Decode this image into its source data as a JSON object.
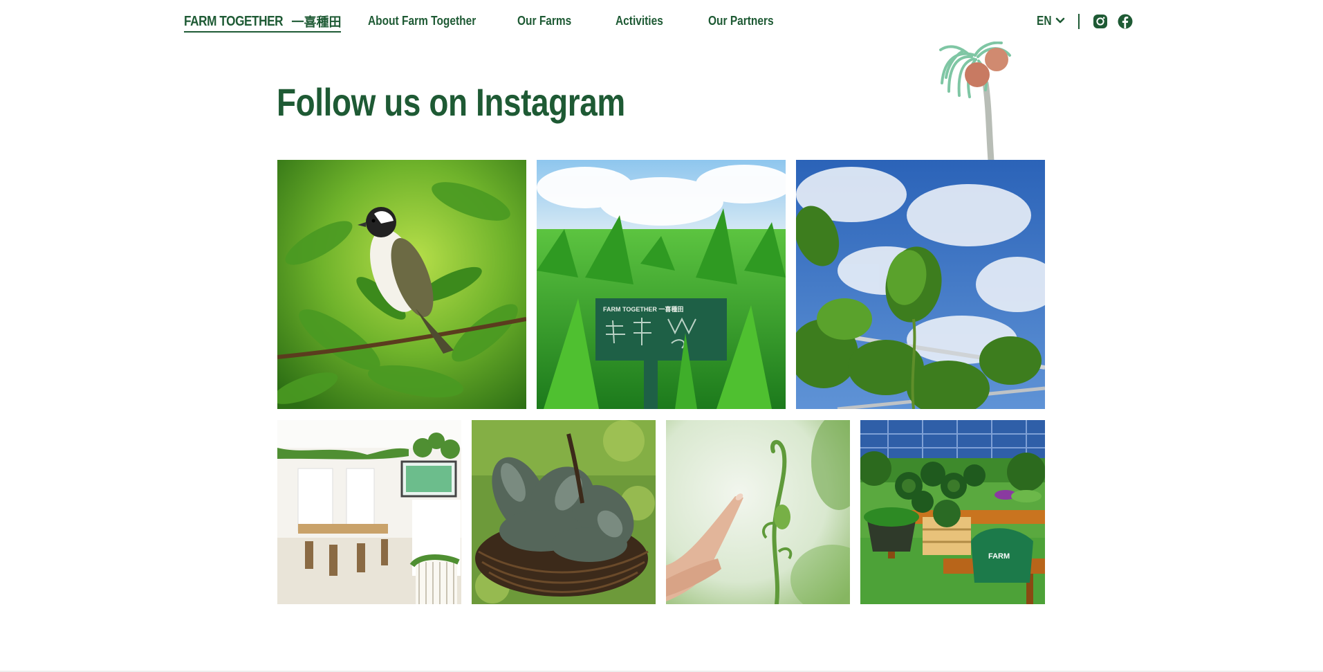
{
  "header": {
    "logo_en": "FARM TOGETHER",
    "logo_zh": "一喜種田",
    "nav": [
      {
        "label": "About Farm Together"
      },
      {
        "label": "Our Farms"
      },
      {
        "label": "Activities"
      },
      {
        "label": "Our Partners"
      }
    ],
    "language": "EN",
    "social": [
      {
        "icon": "instagram-icon"
      },
      {
        "icon": "facebook-icon"
      }
    ]
  },
  "section": {
    "title": "Follow us on Instagram"
  },
  "instagram_posts": [
    {
      "subject": "bird-on-branch"
    },
    {
      "subject": "water-spinach-sign"
    },
    {
      "subject": "rooftop-vines-sky"
    },
    {
      "subject": "indoor-farm-space"
    },
    {
      "subject": "kale-basket"
    },
    {
      "subject": "finger-pointing-at-tendril"
    },
    {
      "subject": "produce-table"
    }
  ],
  "sign_text": "FARM TOGETHER 一喜種田",
  "colors": {
    "brand_green": "#1e5a34",
    "background": "#ffffff"
  }
}
